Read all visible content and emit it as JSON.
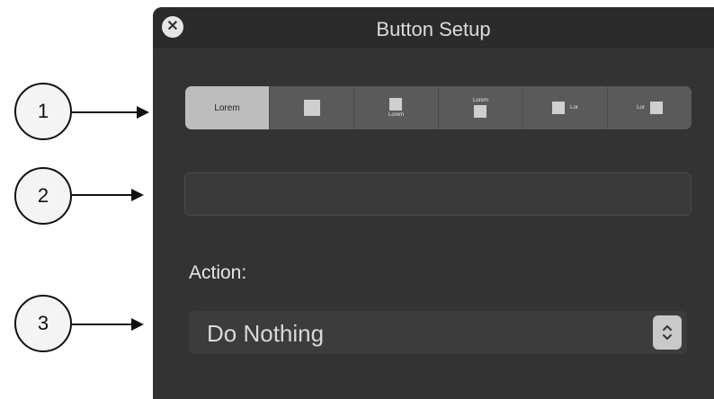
{
  "callouts": [
    "1",
    "2",
    "3"
  ],
  "window": {
    "title": "Button Setup"
  },
  "segmented": {
    "segments": [
      {
        "label": "Lorem",
        "selected": true
      },
      {
        "label": "",
        "icon": "square-icon"
      },
      {
        "label": "Lorem",
        "icon": "square-icon"
      },
      {
        "label": "Lorem",
        "icon": "square-icon"
      },
      {
        "label": "Lor",
        "icon": "square-icon"
      },
      {
        "label": "Lor",
        "icon": "square-icon"
      }
    ]
  },
  "title_field": {
    "value": ""
  },
  "action": {
    "label": "Action:",
    "selected": "Do Nothing"
  },
  "colors": {
    "window_bg": "#333333",
    "segment_selected": "#bdbdbd"
  }
}
